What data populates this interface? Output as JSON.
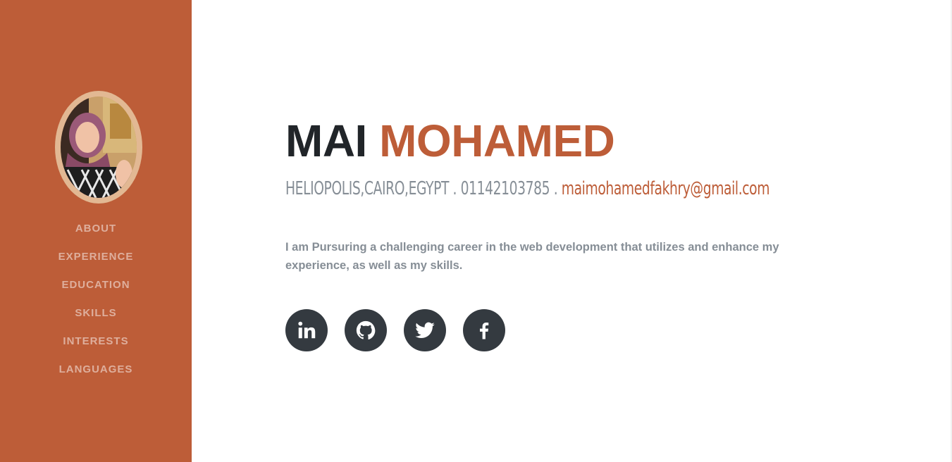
{
  "sidebar": {
    "background": "#bd5d38",
    "avatar_alt": "profile photo",
    "nav": [
      {
        "label": "ABOUT"
      },
      {
        "label": "EXPERIENCE"
      },
      {
        "label": "EDUCATION"
      },
      {
        "label": "SKILLS"
      },
      {
        "label": "INTERESTS"
      },
      {
        "label": "LANGUAGES"
      }
    ]
  },
  "about": {
    "first_name": "MAI",
    "last_name": "MOHAMED",
    "contact_text": "HELIOPOLIS,CAIRO,EGYPT . 01142103785 . ",
    "email": "maimohamedfakhry@gmail.com",
    "lead": "I am Pursuring a challenging career in the web development that utilizes and enhance my experience, as well as my skills."
  },
  "socials": [
    {
      "icon": "linkedin-icon"
    },
    {
      "icon": "github-icon"
    },
    {
      "icon": "twitter-icon"
    },
    {
      "icon": "facebook-icon"
    }
  ],
  "colors": {
    "accent": "#bd5d38",
    "text_dark": "#212529",
    "text_muted": "#868e96",
    "social_bg": "#343a40"
  }
}
